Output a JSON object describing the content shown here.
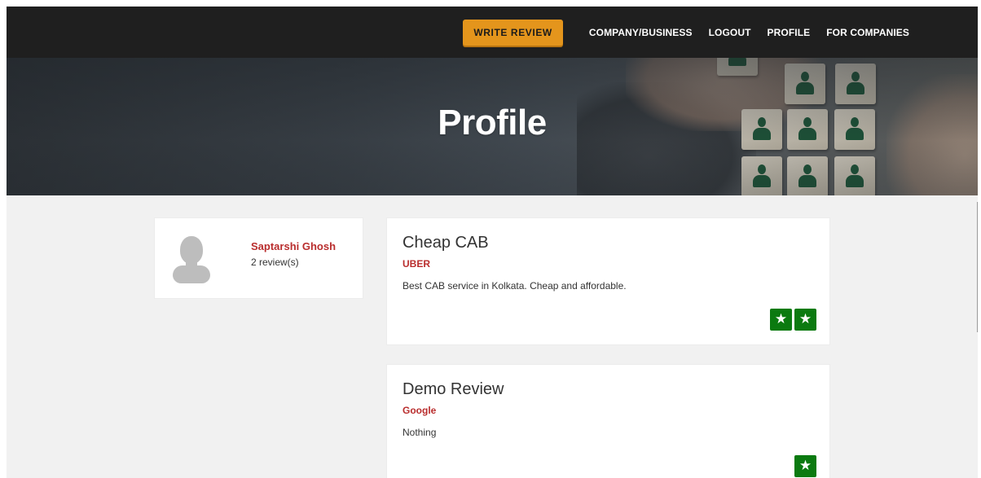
{
  "nav": {
    "write_review": "WRITE REVIEW",
    "links": [
      "COMPANY/BUSINESS",
      "LOGOUT",
      "PROFILE",
      "FOR COMPANIES"
    ]
  },
  "hero": {
    "title": "Profile"
  },
  "profile": {
    "name": "Saptarshi Ghosh",
    "review_count": "2 review(s)",
    "avatar_icon": "person-silhouette-icon"
  },
  "reviews": [
    {
      "title": "Cheap CAB",
      "company": "UBER",
      "text": "Best CAB service in Kolkata. Cheap and affordable.",
      "rating": 2
    },
    {
      "title": "Demo Review",
      "company": "Google",
      "text": "Nothing",
      "rating": 1
    }
  ],
  "colors": {
    "accent": "#e4951c",
    "link_red": "#b92d2d",
    "star_green": "#0b7a10",
    "navbar": "#1f1f1f",
    "background": "#f1f1f1"
  }
}
